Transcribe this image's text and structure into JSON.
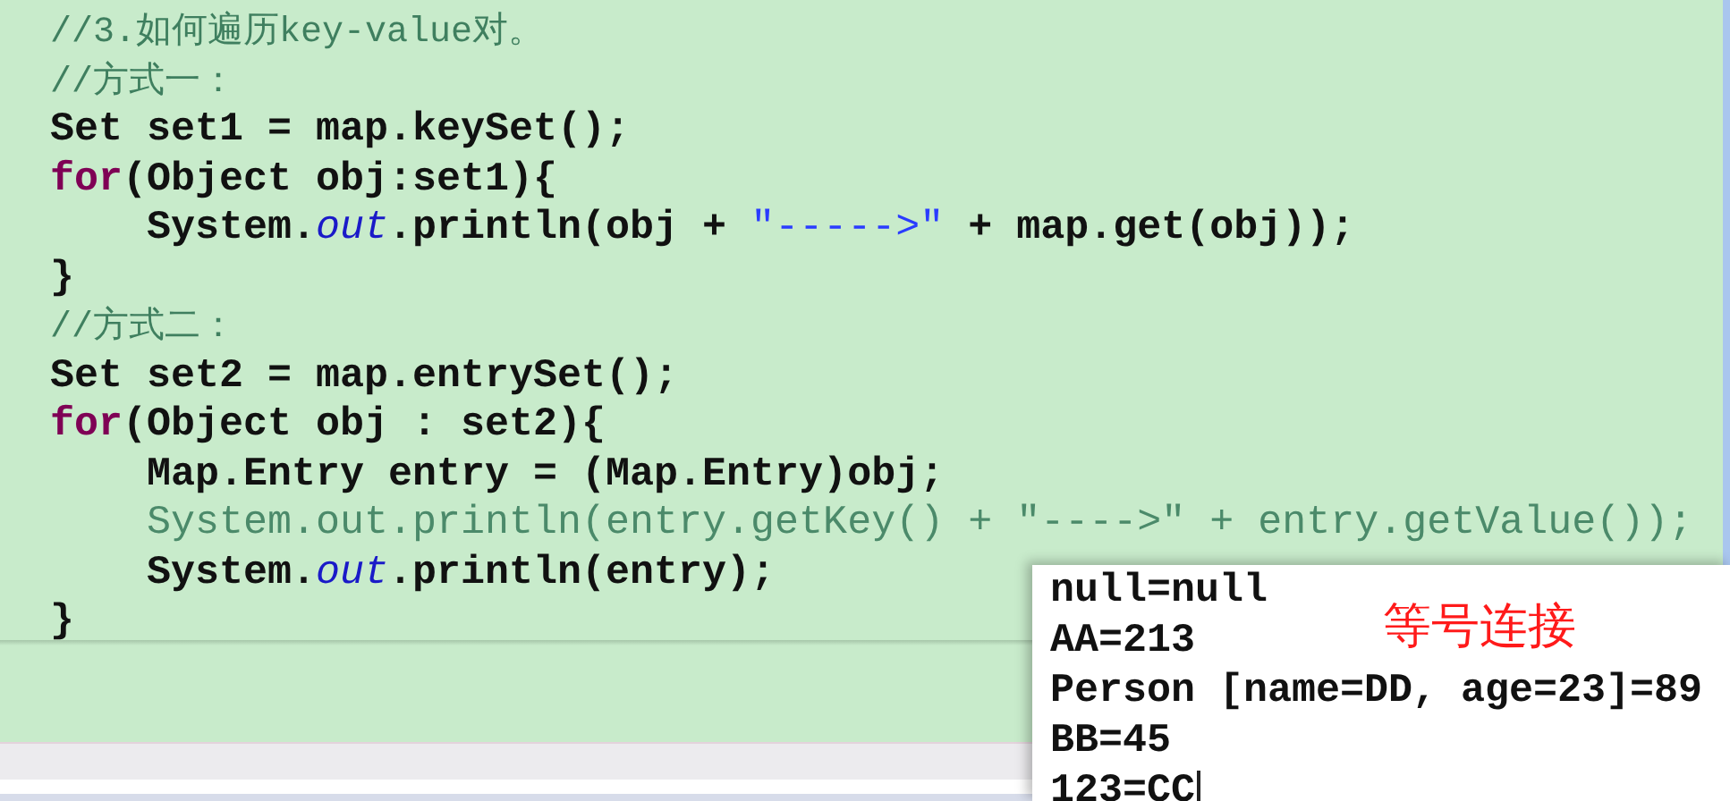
{
  "editor": {
    "lines": [
      {
        "dimmed": false,
        "segments": [
          {
            "kind": "comment",
            "text": "//3.如何遍历key-value对。"
          }
        ]
      },
      {
        "dimmed": false,
        "segments": [
          {
            "kind": "comment",
            "text": "//方式一："
          }
        ]
      },
      {
        "dimmed": false,
        "segments": [
          {
            "kind": "plain",
            "text": "Set set1 = map.keySet();"
          }
        ]
      },
      {
        "dimmed": false,
        "segments": [
          {
            "kind": "keyword",
            "text": "for"
          },
          {
            "kind": "plain",
            "text": "(Object obj:set1){"
          }
        ],
        "children": [
          {
            "dimmed": false,
            "segments": [
              {
                "kind": "plain",
                "text": "System."
              },
              {
                "kind": "field",
                "text": "out"
              },
              {
                "kind": "plain",
                "text": ".println(obj + "
              },
              {
                "kind": "string",
                "text": "\"----->\""
              },
              {
                "kind": "plain",
                "text": " + map.get(obj));"
              }
            ]
          }
        ]
      },
      {
        "dimmed": false,
        "segments": [
          {
            "kind": "plain",
            "text": "}"
          }
        ]
      },
      {
        "dimmed": false,
        "segments": [
          {
            "kind": "comment",
            "text": "//方式二："
          }
        ]
      },
      {
        "dimmed": false,
        "segments": [
          {
            "kind": "plain",
            "text": "Set set2 = map.entrySet();"
          }
        ]
      },
      {
        "dimmed": false,
        "segments": [
          {
            "kind": "keyword",
            "text": "for"
          },
          {
            "kind": "plain",
            "text": "(Object obj : set2){"
          }
        ],
        "children": [
          {
            "dimmed": false,
            "segments": [
              {
                "kind": "plain",
                "text": "Map.Entry entry = (Map.Entry)obj;"
              }
            ]
          },
          {
            "dimmed": true,
            "segments": [
              {
                "kind": "plain",
                "text": "System.out.println(entry.getKey() + \"---->\" + entry.getValue());"
              }
            ]
          },
          {
            "dimmed": false,
            "segments": [
              {
                "kind": "plain",
                "text": "System."
              },
              {
                "kind": "field",
                "text": "out"
              },
              {
                "kind": "plain",
                "text": ".println(entry);"
              }
            ]
          }
        ]
      },
      {
        "dimmed": false,
        "segments": [
          {
            "kind": "plain",
            "text": "}"
          }
        ]
      }
    ]
  },
  "console": {
    "lines": [
      "null=null",
      "AA=213",
      "Person [name=DD, age=23]=89",
      "BB=45",
      "123=CC"
    ],
    "annotation": "等号连接"
  }
}
